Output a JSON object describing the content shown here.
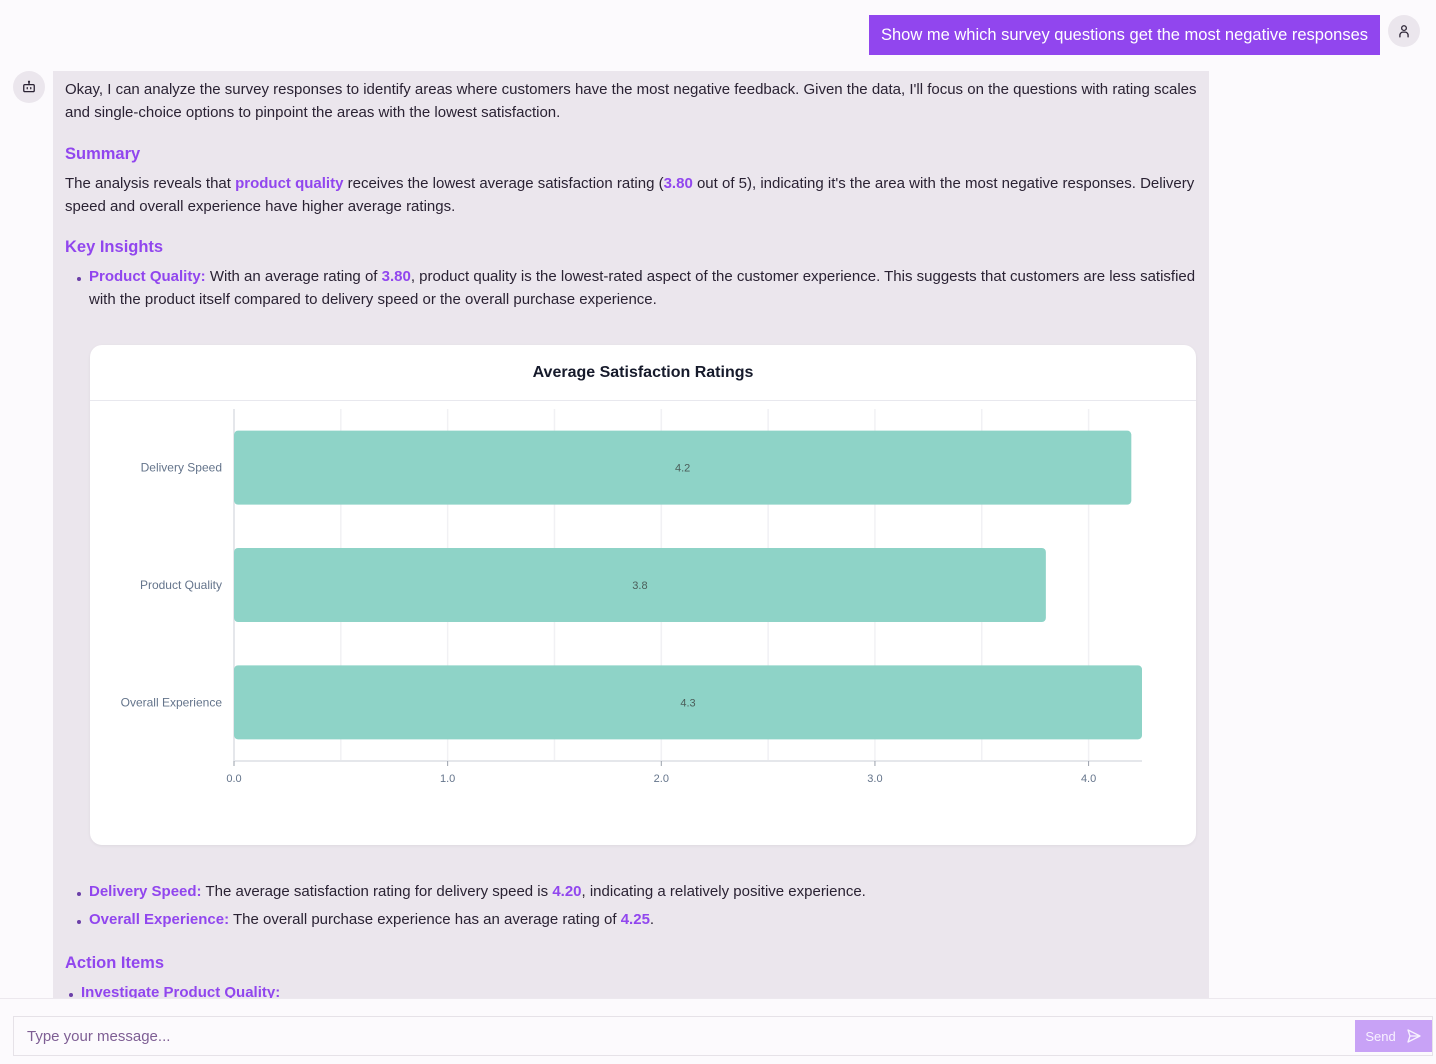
{
  "conversation": {
    "user_message": "Show me which survey questions get the most negative responses",
    "assistant": {
      "intro": "Okay, I can analyze the survey responses to identify areas where customers have the most negative feedback. Given the data, I'll focus on the questions with rating scales and single-choice options to pinpoint the areas with the lowest satisfaction.",
      "summary_heading": "Summary",
      "summary": {
        "part1": "The analysis reveals that ",
        "highlight_topic": "product quality",
        "part2": " receives the lowest average satisfaction rating (",
        "highlight_value": "3.80",
        "part3": " out of 5), indicating it's the area with the most negative responses. Delivery speed and overall experience have higher average ratings."
      },
      "key_insights_heading": "Key Insights",
      "insights": [
        {
          "label": "Product Quality:",
          "pre": " With an average rating of ",
          "value": "3.80",
          "post": ", product quality is the lowest-rated aspect of the customer experience. This suggests that customers are less satisfied with the product itself compared to delivery speed or the overall purchase experience."
        },
        {
          "label": "Delivery Speed:",
          "pre": " The average satisfaction rating for delivery speed is ",
          "value": "4.20",
          "post": ", indicating a relatively positive experience."
        },
        {
          "label": "Overall Experience:",
          "pre": " The overall purchase experience has an average rating of ",
          "value": "4.25",
          "post": "."
        }
      ],
      "action_items_heading": "Action Items",
      "action_items": [
        {
          "label": "Investigate Product Quality:"
        }
      ]
    }
  },
  "input": {
    "placeholder": "Type your message...",
    "value": "",
    "send_label": "Send"
  },
  "icons": {
    "user_avatar": "user-icon",
    "bot_avatar": "bot-icon",
    "send": "send-icon"
  },
  "colors": {
    "accent": "#9146ee",
    "bar": "#8ed3c7",
    "send_button": "#c8a2f6",
    "bubble_bg": "#ebe6ed"
  },
  "chart_data": {
    "type": "bar",
    "orientation": "horizontal",
    "title": "Average Satisfaction Ratings",
    "categories": [
      "Delivery Speed",
      "Product Quality",
      "Overall Experience"
    ],
    "values": [
      4.2,
      3.8,
      4.25
    ],
    "data_labels": [
      "4.2",
      "3.8",
      "4.3"
    ],
    "xlabel": "",
    "ylabel": "",
    "xlim": [
      0,
      4.25
    ],
    "x_ticks": [
      0,
      1,
      2,
      3,
      4
    ],
    "x_tick_labels": [
      "0.0",
      "1.0",
      "2.0",
      "3.0",
      "4.0"
    ],
    "grid": true,
    "grid_step": 0.5,
    "legend": "none"
  }
}
